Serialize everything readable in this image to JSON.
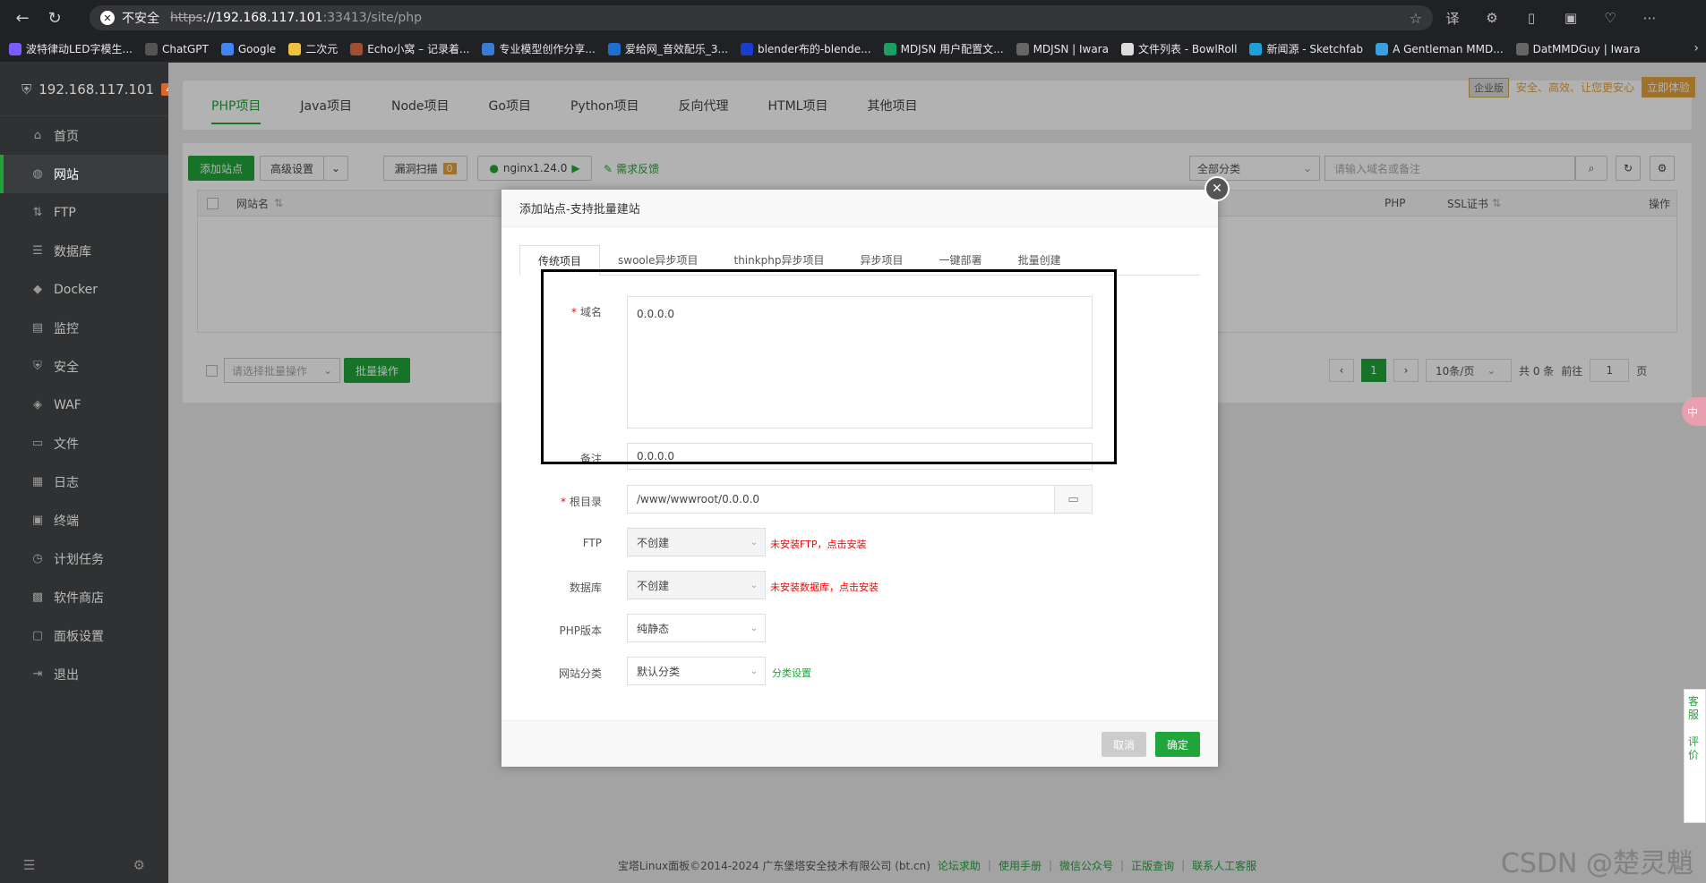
{
  "browser": {
    "insecure_label": "不安全",
    "url_scheme": "https",
    "url_host": "://192.168.117.101",
    "url_rest": ":33413/site/php"
  },
  "bookmarks": [
    {
      "label": "波特律动LED字模生...",
      "color": "#7b5cff"
    },
    {
      "label": "ChatGPT",
      "color": "#555555"
    },
    {
      "label": "Google",
      "color": "#4285f4"
    },
    {
      "label": "二次元",
      "color": "#f0c040"
    },
    {
      "label": "Echo小窝 – 记录着...",
      "color": "#a05030"
    },
    {
      "label": "专业模型创作分享...",
      "color": "#3a7bd5"
    },
    {
      "label": "爱给网_音效配乐_3...",
      "color": "#1f6fd0"
    },
    {
      "label": "blender布的-blende...",
      "color": "#1a3ccf"
    },
    {
      "label": "MDJSN 用户配置文...",
      "color": "#1aa060"
    },
    {
      "label": "MDJSN | Iwara",
      "color": "#666666"
    },
    {
      "label": "文件列表 - BowlRoll",
      "color": "#dddddd"
    },
    {
      "label": "新闻源 - Sketchfab",
      "color": "#1ca0d8"
    },
    {
      "label": "A Gentleman MMD...",
      "color": "#3aa0e0"
    },
    {
      "label": "DatMMDGuy | Iwara",
      "color": "#666666"
    }
  ],
  "sidebar": {
    "host": "192.168.117.101",
    "badge": "4",
    "items": [
      {
        "label": "首页",
        "icon": "home-icon"
      },
      {
        "label": "网站",
        "icon": "globe-icon"
      },
      {
        "label": "FTP",
        "icon": "ftp-icon"
      },
      {
        "label": "数据库",
        "icon": "database-icon"
      },
      {
        "label": "Docker",
        "icon": "docker-icon"
      },
      {
        "label": "监控",
        "icon": "monitor-icon"
      },
      {
        "label": "安全",
        "icon": "shield-icon"
      },
      {
        "label": "WAF",
        "icon": "waf-icon"
      },
      {
        "label": "文件",
        "icon": "folder-icon"
      },
      {
        "label": "日志",
        "icon": "log-icon"
      },
      {
        "label": "终端",
        "icon": "terminal-icon"
      },
      {
        "label": "计划任务",
        "icon": "clock-icon"
      },
      {
        "label": "软件商店",
        "icon": "store-icon"
      },
      {
        "label": "面板设置",
        "icon": "settings-icon"
      },
      {
        "label": "退出",
        "icon": "logout-icon"
      }
    ],
    "active_index": 1
  },
  "project_tabs": [
    "PHP项目",
    "Java项目",
    "Node项目",
    "Go项目",
    "Python项目",
    "反向代理",
    "HTML项目",
    "其他项目"
  ],
  "enterprise": {
    "badge": "企业版",
    "slogan": "安全、高效、让您更安心",
    "button": "立即体验"
  },
  "toolbar": {
    "add_site": "添加站点",
    "advanced": "高级设置",
    "vuln_scan": "漏洞扫描",
    "vuln_count": "0",
    "nginx": "nginx1.24.0",
    "feedback": "需求反馈",
    "category": "全部分类",
    "search_placeholder": "请输入域名或备注"
  },
  "table": {
    "col_name": "网站名",
    "col_php": "PHP",
    "col_ssl": "SSL证书",
    "col_ops": "操作"
  },
  "bulk": {
    "select_placeholder": "请选择批量操作",
    "button": "批量操作"
  },
  "pager": {
    "current": "1",
    "per_page": "10条/页",
    "total": "共 0 条",
    "goto": "前往",
    "goto_value": "1",
    "page_unit": "页"
  },
  "modal": {
    "title": "添加站点-支持批量建站",
    "tabs": [
      "传统项目",
      "swoole异步项目",
      "thinkphp异步项目",
      "异步项目",
      "一键部署",
      "批量创建"
    ],
    "domain_label": "域名",
    "domain_value": "0.0.0.0",
    "remark_label": "备注",
    "remark_value": "0.0.0.0",
    "root_label": "根目录",
    "root_value": "/www/wwwroot/0.0.0.0",
    "ftp_label": "FTP",
    "ftp_value": "不创建",
    "ftp_warn": "未安装FTP，点击安装",
    "db_label": "数据库",
    "db_value": "不创建",
    "db_warn": "未安装数据库，点击安装",
    "php_label": "PHP版本",
    "php_value": "纯静态",
    "cat_label": "网站分类",
    "cat_value": "默认分类",
    "cat_link": "分类设置",
    "cancel": "取消",
    "ok": "确定"
  },
  "footer": {
    "copyright": "宝塔Linux面板©2014-2024 广东堡塔安全技术有限公司 (bt.cn)",
    "links": [
      "论坛求助",
      "使用手册",
      "微信公众号",
      "正版查询",
      "联系人工客服"
    ]
  },
  "watermark": "CSDN @楚灵魈",
  "side_float": {
    "pink": "中",
    "service": "客服",
    "review": "评价"
  }
}
